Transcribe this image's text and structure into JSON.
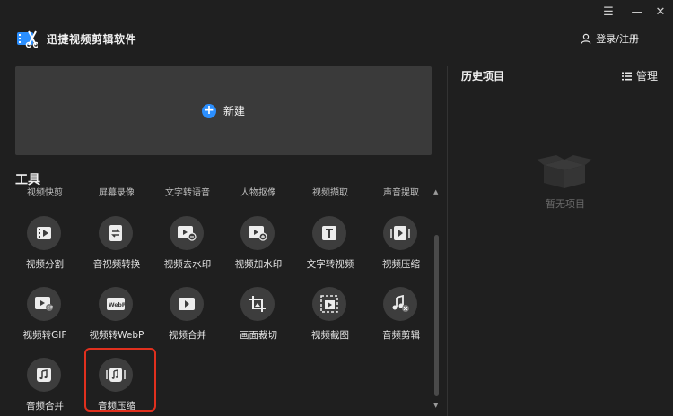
{
  "window": {
    "menu_icon": "hamburger-icon",
    "minimize_icon": "minimize-icon",
    "close_icon": "close-icon"
  },
  "app": {
    "title": "迅捷视频剪辑软件",
    "login_label": "登录/注册"
  },
  "new_project": {
    "label": "新建",
    "accent": "#2b8fff"
  },
  "tools": {
    "title": "工具",
    "peek_row": [
      "视频快剪",
      "屏幕录像",
      "文字转语音",
      "人物抠像",
      "视频擷取",
      "声音提取"
    ],
    "items": [
      {
        "label": "视频分割",
        "icon": "film-split-icon"
      },
      {
        "label": "音视频转换",
        "icon": "convert-icon"
      },
      {
        "label": "视频去水印",
        "icon": "remove-watermark-icon"
      },
      {
        "label": "视频加水印",
        "icon": "add-watermark-icon"
      },
      {
        "label": "文字转视频",
        "icon": "text-to-video-icon"
      },
      {
        "label": "视频压缩",
        "icon": "video-compress-icon"
      },
      {
        "label": "视频转GIF",
        "icon": "gif-icon"
      },
      {
        "label": "视频转WebP",
        "icon": "webp-icon"
      },
      {
        "label": "视频合并",
        "icon": "video-merge-icon"
      },
      {
        "label": "画面裁切",
        "icon": "crop-icon"
      },
      {
        "label": "视频截图",
        "icon": "screenshot-icon"
      },
      {
        "label": "音频剪辑",
        "icon": "audio-cut-icon"
      },
      {
        "label": "音频合并",
        "icon": "audio-merge-icon"
      },
      {
        "label": "音频压缩",
        "icon": "audio-compress-icon"
      }
    ],
    "highlight_color": "#e0301e"
  },
  "history": {
    "title": "历史项目",
    "manage_label": "管理",
    "empty_text": "暂无项目"
  }
}
